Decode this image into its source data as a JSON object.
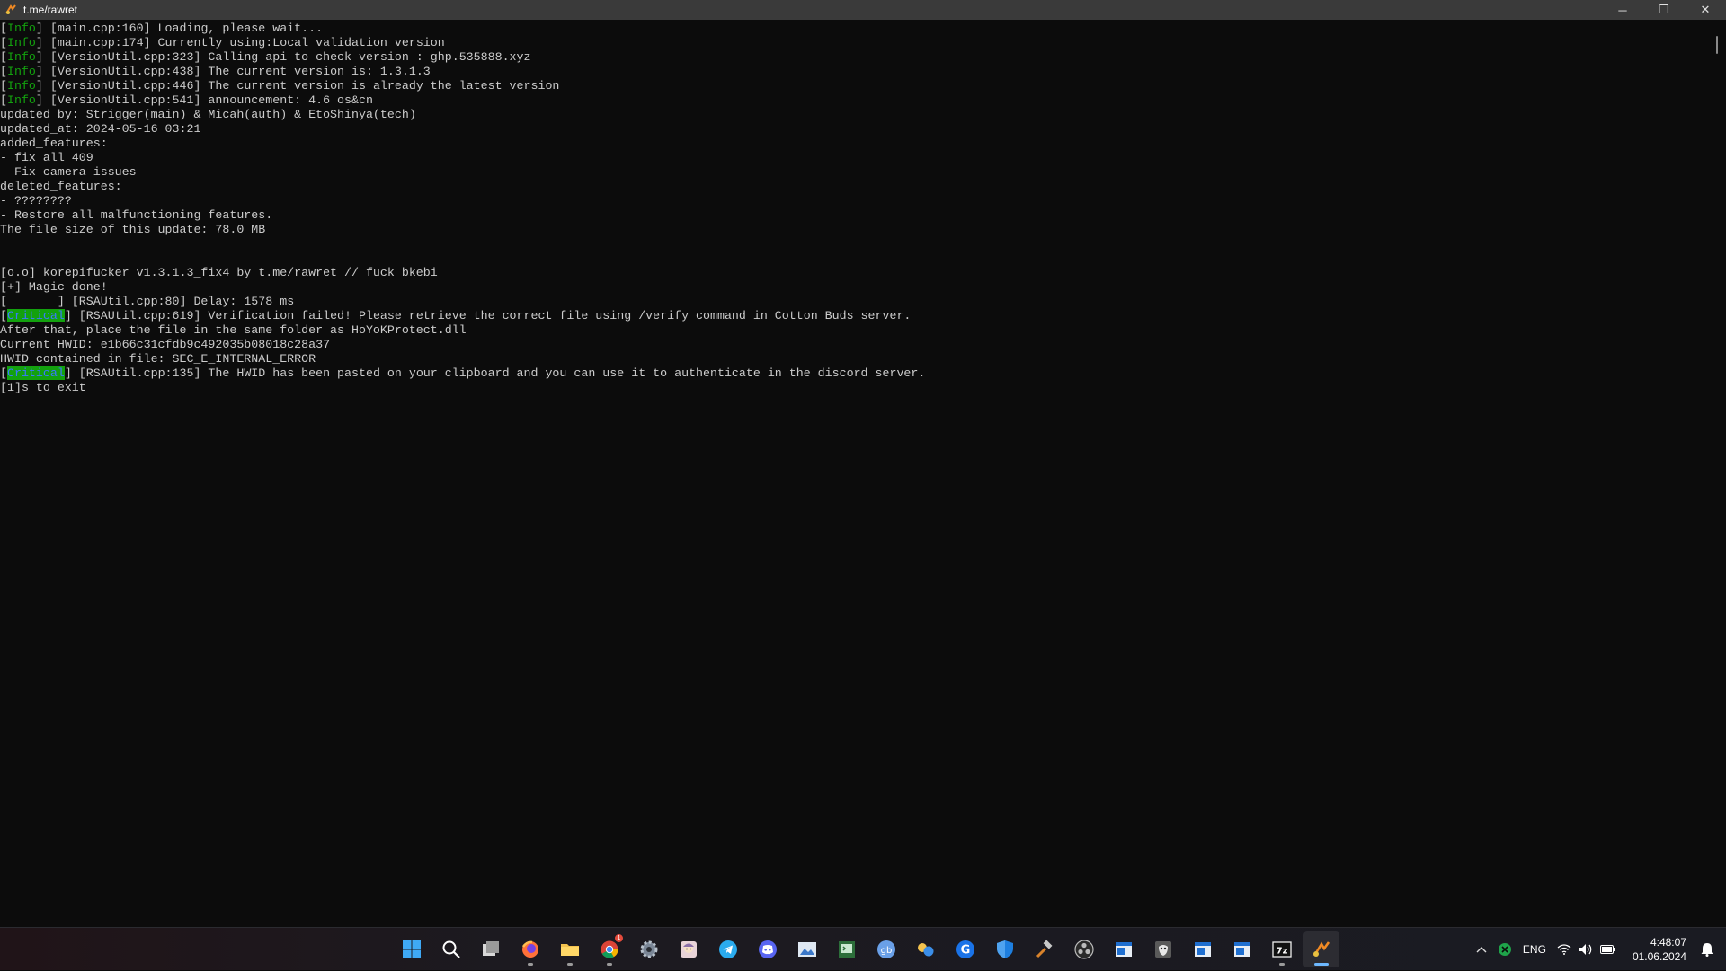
{
  "window": {
    "title": "t.me/rawret",
    "minimize_glyph": "─",
    "maximize_glyph": "❐",
    "close_glyph": "✕"
  },
  "console": {
    "lines": [
      {
        "tag": "Info",
        "tag_style": "info",
        "text": " [main.cpp:160] Loading, please wait..."
      },
      {
        "tag": "Info",
        "tag_style": "info",
        "text": " [main.cpp:174] Currently using:Local validation version"
      },
      {
        "tag": "Info",
        "tag_style": "info",
        "text": " [VersionUtil.cpp:323] Calling api to check version : ghp.535888.xyz"
      },
      {
        "tag": "Info",
        "tag_style": "info",
        "text": " [VersionUtil.cpp:438] The current version is: 1.3.1.3"
      },
      {
        "tag": "Info",
        "tag_style": "info",
        "text": " [VersionUtil.cpp:446] The current version is already the latest version"
      },
      {
        "tag": "Info",
        "tag_style": "info",
        "text": " [VersionUtil.cpp:541] announcement: 4.6 os&cn"
      },
      {
        "text": "updated_by: Strigger(main) & Micah(auth) & EtoShinya(tech)"
      },
      {
        "text": "updated_at: 2024-05-16 03:21"
      },
      {
        "text": "added_features:"
      },
      {
        "text": "- fix all 409"
      },
      {
        "text": "- Fix camera issues"
      },
      {
        "text": "deleted_features:"
      },
      {
        "text": "- ????????"
      },
      {
        "text": "- Restore all malfunctioning features."
      },
      {
        "text": "The file size of this update: 78.0 MB"
      },
      {
        "text": ""
      },
      {
        "text": ""
      },
      {
        "text": "[o.o] korepifucker v1.3.1.3_fix4 by t.me/rawret // fuck bkebi"
      },
      {
        "text": "[+] Magic done!"
      },
      {
        "tag": "       ",
        "tag_style": "blank",
        "text": " [RSAUtil.cpp:80] Delay: 1578 ms"
      },
      {
        "tag": "Critical",
        "tag_style": "crit",
        "text": " [RSAUtil.cpp:619] Verification failed! Please retrieve the correct file using /verify command in Cotton Buds server."
      },
      {
        "text": "After that, place the file in the same folder as HoYoKProtect.dll"
      },
      {
        "text": "Current HWID: e1b66c31cfdb9c492035b08018c28a37"
      },
      {
        "text": "HWID contained in file: SEC_E_INTERNAL_ERROR"
      },
      {
        "tag": "Critical",
        "tag_style": "crit",
        "text": " [RSAUtil.cpp:135] The HWID has been pasted on your clipboard and you can use it to authenticate in the discord server."
      },
      {
        "text": "[1]s to exit"
      }
    ]
  },
  "taskbar": {
    "apps": [
      {
        "name": "start-menu",
        "icon": "windows-logo-icon",
        "running": false,
        "active": false
      },
      {
        "name": "search",
        "icon": "search-icon",
        "running": false,
        "active": false
      },
      {
        "name": "task-view",
        "icon": "task-view-icon",
        "running": false,
        "active": false
      },
      {
        "name": "firefox",
        "icon": "firefox-icon",
        "running": true,
        "active": false
      },
      {
        "name": "file-explorer",
        "icon": "folder-icon",
        "running": true,
        "active": false
      },
      {
        "name": "chrome",
        "icon": "chrome-icon",
        "running": true,
        "active": false,
        "badge": "1"
      },
      {
        "name": "settings",
        "icon": "gear-icon",
        "running": false,
        "active": false
      },
      {
        "name": "anime-app",
        "icon": "character-avatar-icon",
        "running": false,
        "active": false
      },
      {
        "name": "telegram",
        "icon": "telegram-icon",
        "running": false,
        "active": false
      },
      {
        "name": "discord",
        "icon": "discord-icon",
        "running": false,
        "active": false
      },
      {
        "name": "photo-viewer",
        "icon": "image-icon",
        "running": false,
        "active": false
      },
      {
        "name": "terminal-app",
        "icon": "console-icon",
        "running": false,
        "active": false
      },
      {
        "name": "gb-app",
        "icon": "gb-icon",
        "running": false,
        "active": false
      },
      {
        "name": "cloud-app",
        "icon": "cloud-icon",
        "running": false,
        "active": false
      },
      {
        "name": "g-app",
        "icon": "g-letter-icon",
        "running": false,
        "active": false
      },
      {
        "name": "security",
        "icon": "shield-icon",
        "running": false,
        "active": false
      },
      {
        "name": "tool-app",
        "icon": "hammer-icon",
        "running": false,
        "active": false
      },
      {
        "name": "obs",
        "icon": "obs-icon",
        "running": false,
        "active": false
      },
      {
        "name": "window-app-1",
        "icon": "window-icon",
        "running": false,
        "active": false
      },
      {
        "name": "hacker-app",
        "icon": "mask-icon",
        "running": false,
        "active": false
      },
      {
        "name": "window-app-2",
        "icon": "window-icon",
        "running": false,
        "active": false
      },
      {
        "name": "window-app-3",
        "icon": "window-icon",
        "running": false,
        "active": false
      },
      {
        "name": "7zip",
        "icon": "7z-icon",
        "running": true,
        "active": false,
        "label": "7z"
      },
      {
        "name": "current-console",
        "icon": "console-app-icon",
        "running": true,
        "active": true
      }
    ],
    "tray": {
      "overflow_glyph": "^",
      "language": "ENG",
      "time": "4:48:07",
      "date": "01.06.2024"
    }
  },
  "colors": {
    "info_tag": "#13a10e",
    "critical_bg": "#13a10e",
    "critical_fg": "#3b78ff",
    "console_text": "#cccccc",
    "console_bg": "#0c0c0c",
    "titlebar_bg": "#3a3a3a"
  }
}
